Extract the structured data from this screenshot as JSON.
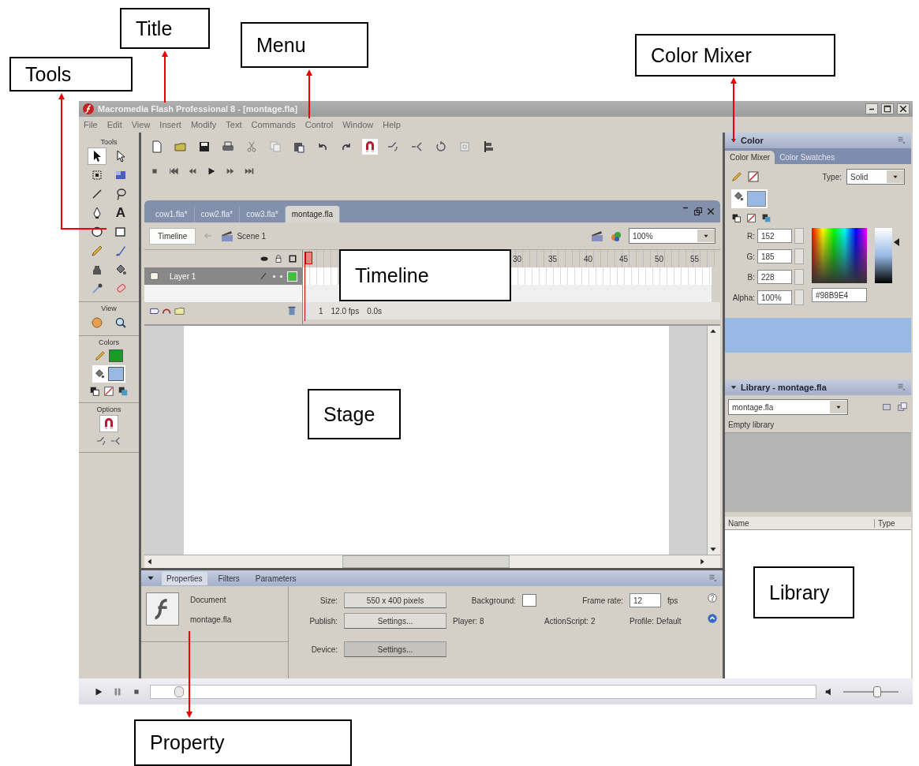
{
  "callouts": [
    {
      "label": "Tools"
    },
    {
      "label": "Title"
    },
    {
      "label": "Menu"
    },
    {
      "label": "Color Mixer"
    },
    {
      "label": "Timeline"
    },
    {
      "label": "Stage"
    },
    {
      "label": "Library"
    },
    {
      "label": "Property"
    }
  ],
  "window": {
    "title": "Macromedia Flash Professional 8 - [montage.fla]"
  },
  "menu": [
    "File",
    "Edit",
    "View",
    "Insert",
    "Modify",
    "Text",
    "Commands",
    "Control",
    "Window",
    "Help"
  ],
  "tools": {
    "title": "Tools",
    "items": [
      {
        "kind": "arrow",
        "selected": true
      },
      {
        "kind": "subselect",
        "selected": false
      },
      {
        "kind": "transform",
        "selected": false
      },
      {
        "kind": "gradient",
        "selected": false
      },
      {
        "kind": "line",
        "selected": false
      },
      {
        "kind": "lasso",
        "selected": false
      },
      {
        "kind": "pen",
        "selected": false
      },
      {
        "kind": "text",
        "label": "A",
        "selected": false
      },
      {
        "kind": "oval",
        "selected": false
      },
      {
        "kind": "rectangle",
        "selected": false
      },
      {
        "kind": "pencil",
        "selected": false
      },
      {
        "kind": "brush",
        "selected": false
      },
      {
        "kind": "ink",
        "selected": false
      },
      {
        "kind": "bucket",
        "selected": false
      },
      {
        "kind": "dropper",
        "selected": false
      },
      {
        "kind": "eraser",
        "selected": false
      }
    ],
    "view_title": "View",
    "colors_title": "Colors",
    "fill_selected": true,
    "options_title": "Options",
    "snap_on": true
  },
  "document": {
    "tabs": [
      {
        "label": "cow1.fla*",
        "selected": false
      },
      {
        "label": "cow2.fla*",
        "selected": false
      },
      {
        "label": "cow3.fla*",
        "selected": false
      },
      {
        "label": "montage.fla",
        "selected": true
      }
    ],
    "timeline_button": "Timeline",
    "scene": "Scene 1",
    "zoom": "100%",
    "layers": [
      {
        "name": "Layer 1",
        "selected": true
      }
    ],
    "ruler": [
      "30",
      "35",
      "40",
      "45",
      "50",
      "55"
    ],
    "frame": "1",
    "fps": "12.0 fps",
    "time": "0.0s"
  },
  "properties": {
    "tabs": [
      {
        "label": "Properties",
        "selected": true
      },
      {
        "label": "Filters",
        "selected": false
      },
      {
        "label": "Parameters",
        "selected": false
      }
    ],
    "doc_type": "Document",
    "doc_name": "montage.fla",
    "size_label": "Size:",
    "size": "550 x 400 pixels",
    "background_label": "Background:",
    "frame_rate_label": "Frame rate:",
    "frame_rate": "12",
    "fps": "fps",
    "publish_label": "Publish:",
    "publish_button": "Settings...",
    "player": "Player: 8",
    "actionscript": "ActionScript: 2",
    "profile": "Profile: Default",
    "device_label": "Device:",
    "device_button": "Settings..."
  },
  "color_panel": {
    "title": "Color",
    "tabs": [
      {
        "label": "Color Mixer",
        "selected": true
      },
      {
        "label": "Color Swatches",
        "selected": false
      }
    ],
    "type_label": "Type:",
    "type_value": "Solid",
    "brightness": {
      "level": 0.75
    },
    "channels": [
      {
        "label": "R:",
        "value": "152"
      },
      {
        "label": "G:",
        "value": "185"
      },
      {
        "label": "B:",
        "value": "228"
      },
      {
        "label": "Alpha:",
        "value": "100%"
      }
    ],
    "hex": "#98B9E4"
  },
  "library": {
    "title": "Library - montage.fla",
    "document": "montage.fla",
    "status": "Empty library",
    "columns": [
      "Name",
      "Type"
    ]
  },
  "playbar": {
    "volume": {
      "level": 0.6
    }
  }
}
